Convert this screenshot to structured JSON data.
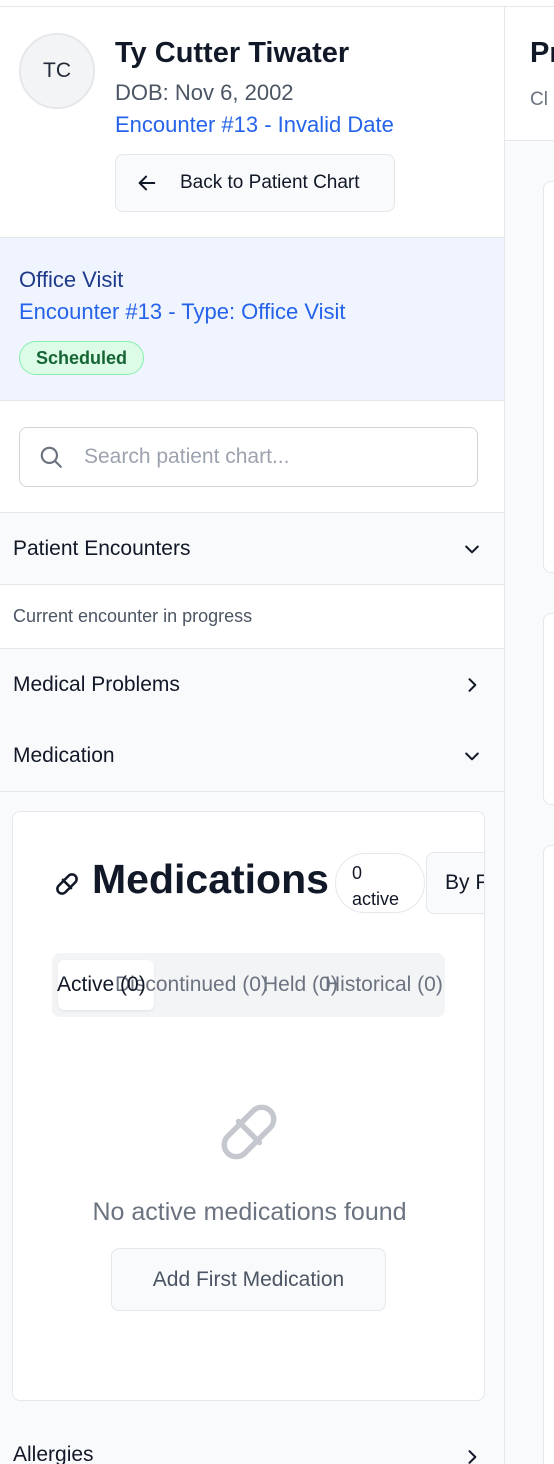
{
  "patient": {
    "initials": "TC",
    "name": "Ty Cutter Tiwater",
    "dob": "DOB: Nov 6, 2002",
    "encounter_link": "Encounter #13 - Invalid Date",
    "back_button": "Back to Patient Chart"
  },
  "visit": {
    "title": "Office Visit",
    "subtitle": "Encounter #13 - Type: Office Visit",
    "status": "Scheduled"
  },
  "search": {
    "placeholder": "Search patient chart..."
  },
  "sections": {
    "encounters": "Patient Encounters",
    "encounters_note": "Current encounter in progress",
    "problems": "Medical Problems",
    "medication": "Medication",
    "allergies": "Allergies"
  },
  "medications": {
    "title": "Medications",
    "active_count": "0",
    "active_word": "active",
    "by_provider": "By Provider",
    "tabs": {
      "active": "Active (0)",
      "discontinued": "Discontinued (0)",
      "held": "Held (0)",
      "historical": "Historical (0)"
    },
    "empty": "No active medications found",
    "add_button": "Add First Medication"
  },
  "right_panel": {
    "title": "Pr",
    "subtitle": "Cl"
  },
  "icons": [
    "arrow-left-icon",
    "search-icon",
    "chevron-down-icon",
    "chevron-right-icon",
    "pill-icon"
  ]
}
